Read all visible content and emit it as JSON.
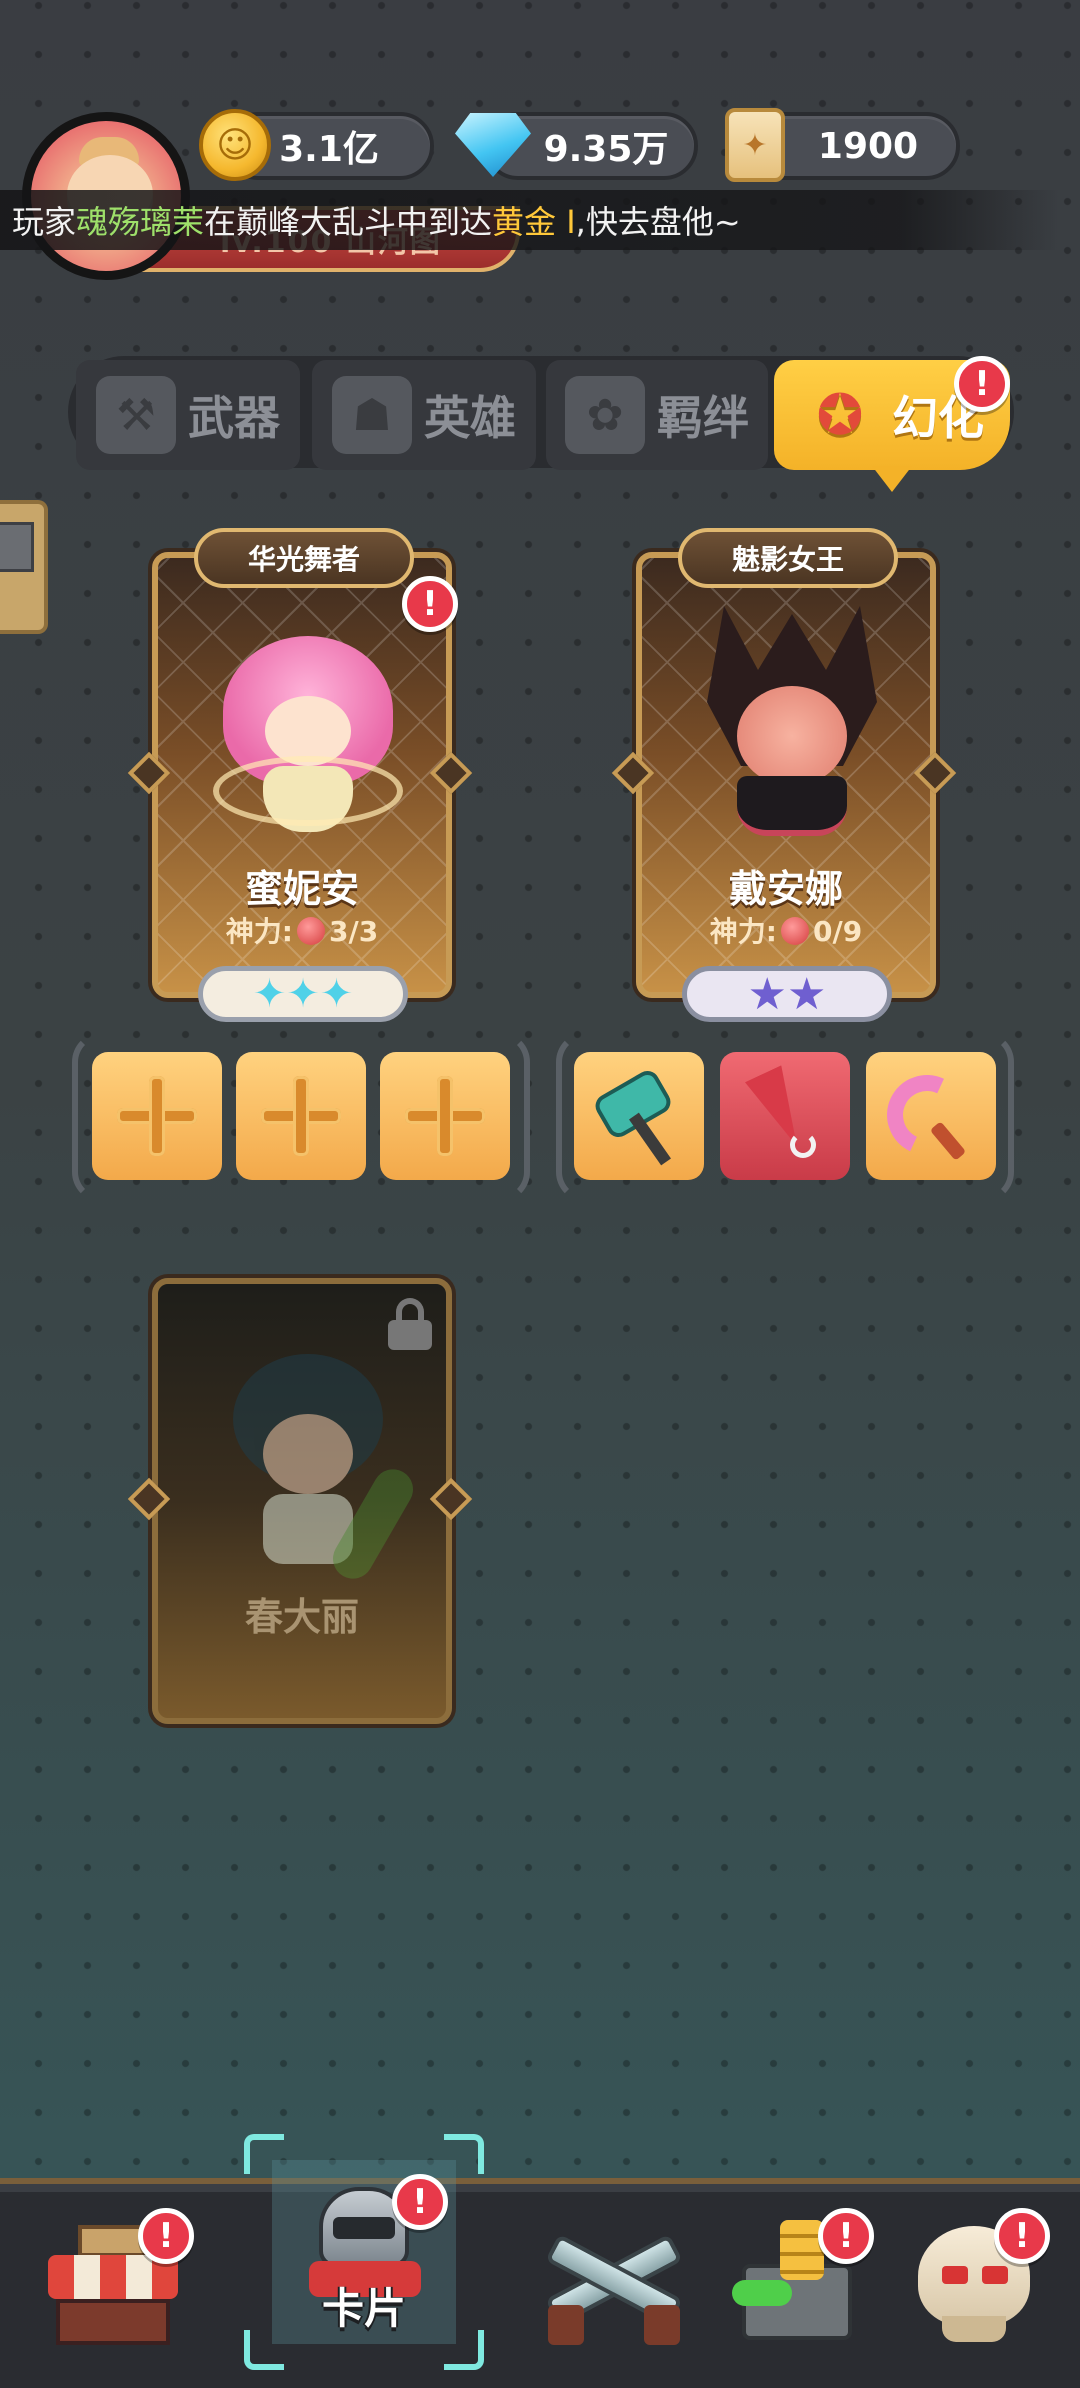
{
  "resources": {
    "gold": "3.1亿",
    "diamonds": "9.35万",
    "scrolls": "1900"
  },
  "player": {
    "level_banner": "lv.100 山河图"
  },
  "announcement": {
    "prefix": "玩家",
    "player_name": "魂殇璃茉",
    "middle": "在巅峰大乱斗中到达",
    "rank": "黄金 I",
    "suffix": ",快去盘他~"
  },
  "tabs": [
    {
      "label": "武器",
      "icon": "weapon-icon",
      "active": false
    },
    {
      "label": "英雄",
      "icon": "hero-icon",
      "active": false
    },
    {
      "label": "羁绊",
      "icon": "bond-icon",
      "active": false
    },
    {
      "label": "幻化",
      "icon": "transform-icon",
      "active": true,
      "badge": "!"
    }
  ],
  "cards": [
    {
      "title": "华光舞者",
      "name": "蜜妮安",
      "power_label": "神力:",
      "power_value": "3/3",
      "stars_type": "diamond",
      "stars": "✦✦✦",
      "badge": "!",
      "locked": false
    },
    {
      "title": "魅影女王",
      "name": "戴安娜",
      "power_label": "神力:",
      "power_value": "0/9",
      "stars_type": "purple-star",
      "stars": "★★",
      "locked": false
    },
    {
      "name": "春大丽",
      "locked": true
    }
  ],
  "equipment": {
    "card1_slots": [
      "empty",
      "empty",
      "empty"
    ],
    "card2_slots": [
      "hammer-icon",
      "umbrella-icon",
      "tentacle-whip-icon"
    ]
  },
  "bottom_nav": [
    {
      "id": "shop",
      "icon": "shop-icon",
      "badge": "!"
    },
    {
      "id": "cards",
      "icon": "knight-helmet-icon",
      "label": "卡片",
      "badge": "!",
      "selected": true
    },
    {
      "id": "battle",
      "icon": "crossed-guns-icon"
    },
    {
      "id": "treasury",
      "icon": "treasure-vault-icon",
      "badge": "!"
    },
    {
      "id": "boss",
      "icon": "skull-icon",
      "badge": "!"
    }
  ],
  "colors": {
    "tab_active": "#f4b228",
    "badge_red": "#e8394a",
    "announcement_name": "#9ee06a",
    "announcement_rank": "#ffc83a",
    "selection_corner": "#7fe9e0"
  }
}
